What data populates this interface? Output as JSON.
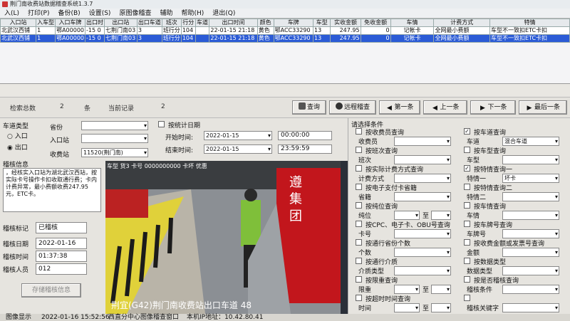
{
  "window": {
    "title": "荆门南收费站数据稽查系统1.3.7"
  },
  "menu": [
    "入(L)",
    "打印(P)",
    "备份(B)",
    "设置(S)",
    "原图像稽查",
    "辅助",
    "帮助(H)",
    "退出(Q)"
  ],
  "grid": {
    "headers": [
      "入口站",
      "入车型",
      "入口车牌",
      "出口时",
      "出口站",
      "出口车道",
      "班次",
      "行分",
      "车道",
      "出口时间",
      "颜色",
      "车牌",
      "车型",
      "实收金额",
      "免收金额",
      "车情",
      "计费方式",
      "特情"
    ],
    "rows": [
      [
        "北武汉西铺",
        "1",
        "鄂A00000",
        "-15 0",
        "七荆门南03",
        "3",
        "班行分",
        "104",
        "22-01-15 21:18",
        "黄色",
        "鄂ACC33290",
        "13",
        "247.95",
        "0",
        "记帐卡",
        "全网最小费额",
        "车型不一致扣ETC卡扣"
      ],
      [
        "北武汉西铺",
        "1",
        "鄂A00000",
        "-15 0",
        "七荆门南03",
        "3",
        "班行分",
        "104",
        "22-01-15 21:18",
        "黄色",
        "鄂ACC33290",
        "13",
        "247.95",
        "0",
        "记帐卡",
        "全网最小费额",
        "车型不一致扣ETC卡扣"
      ]
    ]
  },
  "status": {
    "total_label": "检索总数",
    "total_value": "2",
    "total_unit": "条",
    "current_label": "当前记录",
    "current_value": "2"
  },
  "buttons": {
    "query": "查询",
    "remote": "远程稽查",
    "first": "第一条",
    "prev": "上一条",
    "next": "下一条",
    "last": "最后一条",
    "save": "存储稽核信息"
  },
  "left": {
    "lane_type_label": "车道类型",
    "lane_entry": "入口",
    "lane_exit": "出口",
    "audit_info_label": "稽核信息",
    "audit_text": "，经核实入口站为湖北武汉西站，按实际卡号操作卡扣收取通行费；卡内计费异常，最小费额收费247.95元，ETC卡。",
    "mark_label": "稽核标记",
    "mark_value": "已稽核",
    "date_label": "稽核日期",
    "date_value": "2022-01-16",
    "time_label": "稽核时间",
    "time_value": "01:37:38",
    "person_label": "稽核人员",
    "person_value": "012"
  },
  "filter": {
    "province_label": "省份",
    "entry_label": "入口站",
    "station_label": "收费站",
    "station_value": "11520(荆门南)",
    "by_date": "按统计日期",
    "start_label": "开始时间:",
    "start_date": "2022-01-15",
    "start_time": "00:00:00",
    "end_label": "结束时间:",
    "end_date": "2022-01-15",
    "end_time": "23:59:59"
  },
  "photo": {
    "top_text": "车型 货3 卡号 0000000000 卡坏 优惠",
    "sign_chars": "遵 集 团",
    "bottom_text": "荆宜(G42)荆门南收费站出口车道 48"
  },
  "right": {
    "title": "请选择条件",
    "items": [
      {
        "label": "按收费员查询",
        "sub": "收费员",
        "checked": false
      },
      {
        "label": "按班次查询",
        "sub": "班次",
        "checked": false
      },
      {
        "label": "按实际计费方式查询",
        "sub": "计费方式",
        "checked": false
      },
      {
        "label": "按电子支付卡省籍",
        "sub": "省籍",
        "checked": false
      },
      {
        "label": "按纯位查询",
        "sub": "纯位",
        "extra": "至",
        "checked": false
      },
      {
        "label": "按CPC、电子卡、OBU号查询",
        "sub": "卡号",
        "checked": false
      },
      {
        "label": "按通行省份个数",
        "sub": "个数",
        "checked": false
      },
      {
        "label": "按通行介质",
        "sub": "介质类型",
        "checked": false
      },
      {
        "label": "按限重查询",
        "sub": "限重",
        "extra": "至",
        "checked": false
      },
      {
        "label": "按超时时间查询",
        "sub": "时间",
        "extra": "至",
        "checked": false
      }
    ],
    "items2": [
      {
        "label": "按车道查询",
        "sub": "车道",
        "value": "混合车道",
        "checked": true
      },
      {
        "label": "按车型查询",
        "sub": "车型",
        "checked": false
      },
      {
        "label": "按特情查询一",
        "sub": "特情一",
        "value": "坏卡",
        "checked": true
      },
      {
        "label": "按特情查询二",
        "sub": "特情二",
        "checked": false
      },
      {
        "label": "按车情查询",
        "sub": "车情",
        "checked": false
      },
      {
        "label": "按车牌号查询",
        "sub": "车牌号",
        "checked": false
      },
      {
        "label": "按收费金额或发票号查询",
        "sub": "金额",
        "checked": false
      },
      {
        "label": "按数据类型",
        "sub": "数据类型",
        "checked": false
      },
      {
        "label": "按是否稽核查询",
        "sub": "稽核条件",
        "checked": false
      },
      {
        "label": "",
        "sub": "稽核关键字",
        "checked": false
      }
    ]
  },
  "bottom": {
    "a": "图像显示",
    "b": "2022-01-16 15:52:56",
    "c": "西直分中心图像稽查窗口",
    "d": "本机IP地址：10.42.80.41"
  },
  "colors": {
    "selection": "#2b5bd6",
    "panel": "#e6e4df"
  }
}
